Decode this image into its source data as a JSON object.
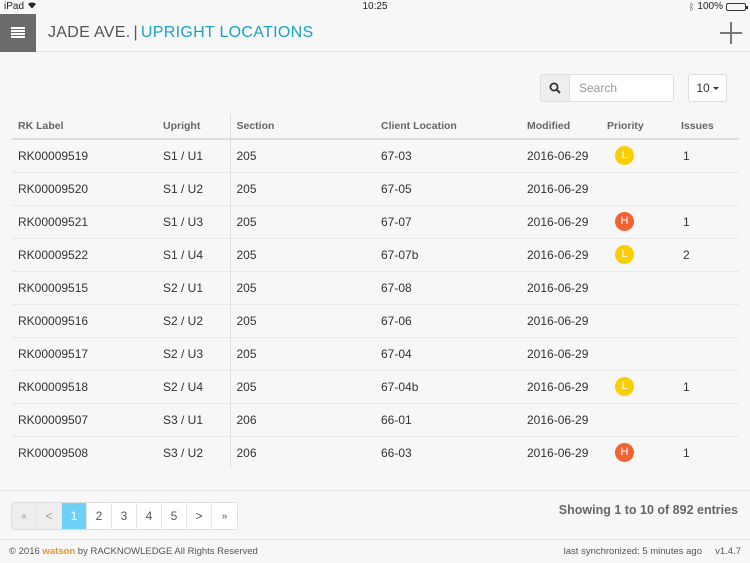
{
  "status_bar": {
    "device": "iPad",
    "time": "10:25",
    "battery": "100%",
    "battery_level_pct": 100
  },
  "header": {
    "site": "JADE AVE.",
    "separator": "|",
    "page_title": "UPRIGHT LOCATIONS"
  },
  "toolbar": {
    "search_placeholder": "Search",
    "search_value": "",
    "page_size": "10"
  },
  "table": {
    "columns": [
      "RK Label",
      "Upright",
      "Section",
      "Client Location",
      "Modified",
      "Priority",
      "Issues"
    ],
    "rows": [
      {
        "rk": "RK00009519",
        "upright": "S1 / U1",
        "section": "205",
        "client": "67-03",
        "modified": "2016-06-29",
        "priority": "L",
        "issues": "1"
      },
      {
        "rk": "RK00009520",
        "upright": "S1 / U2",
        "section": "205",
        "client": "67-05",
        "modified": "2016-06-29",
        "priority": "",
        "issues": ""
      },
      {
        "rk": "RK00009521",
        "upright": "S1 / U3",
        "section": "205",
        "client": "67-07",
        "modified": "2016-06-29",
        "priority": "H",
        "issues": "1"
      },
      {
        "rk": "RK00009522",
        "upright": "S1 / U4",
        "section": "205",
        "client": "67-07b",
        "modified": "2016-06-29",
        "priority": "L",
        "issues": "2"
      },
      {
        "rk": "RK00009515",
        "upright": "S2 / U1",
        "section": "205",
        "client": "67-08",
        "modified": "2016-06-29",
        "priority": "",
        "issues": ""
      },
      {
        "rk": "RK00009516",
        "upright": "S2 / U2",
        "section": "205",
        "client": "67-06",
        "modified": "2016-06-29",
        "priority": "",
        "issues": ""
      },
      {
        "rk": "RK00009517",
        "upright": "S2 / U3",
        "section": "205",
        "client": "67-04",
        "modified": "2016-06-29",
        "priority": "",
        "issues": ""
      },
      {
        "rk": "RK00009518",
        "upright": "S2 / U4",
        "section": "205",
        "client": "67-04b",
        "modified": "2016-06-29",
        "priority": "L",
        "issues": "1"
      },
      {
        "rk": "RK00009507",
        "upright": "S3 / U1",
        "section": "206",
        "client": "66-01",
        "modified": "2016-06-29",
        "priority": "",
        "issues": ""
      },
      {
        "rk": "RK00009508",
        "upright": "S3 / U2",
        "section": "206",
        "client": "66-03",
        "modified": "2016-06-29",
        "priority": "H",
        "issues": "1"
      }
    ]
  },
  "pagination": {
    "first": "«",
    "prev": "<",
    "pages": [
      "1",
      "2",
      "3",
      "4",
      "5"
    ],
    "active_page": "1",
    "next": ">",
    "last": "»",
    "info": "Showing 1 to 10 of 892 entries"
  },
  "footer": {
    "copyright_prefix": "© 2016 ",
    "brand": "watson",
    "copyright_suffix": " by RACKNOWLEDGE All Rights Reserved",
    "sync": "last synchronized: 5 minutes ago",
    "version": "v1.4.7"
  },
  "colors": {
    "accent": "#1ba1c5",
    "priority_low": "#f9cf00",
    "priority_high": "#f06431",
    "active_page": "#6dd0f5",
    "brand": "#f0922a"
  }
}
